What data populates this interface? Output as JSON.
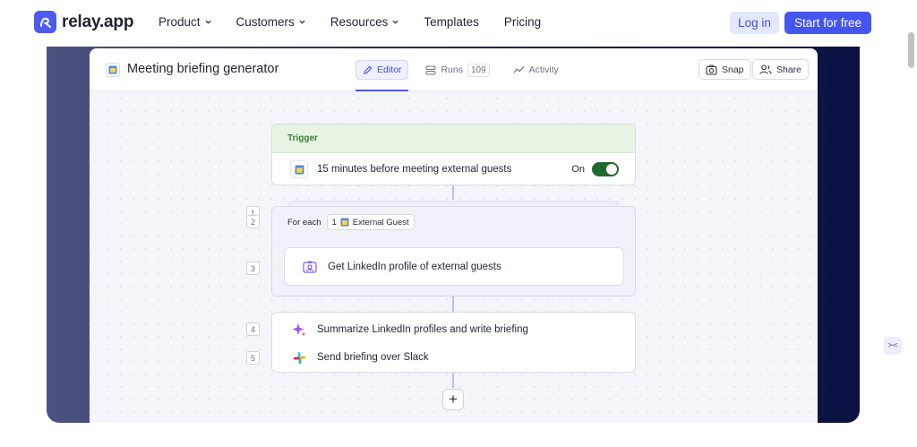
{
  "brand": {
    "name": "relay.app",
    "accent": "#4556f0"
  },
  "nav": {
    "items": [
      {
        "label": "Product",
        "has_menu": true
      },
      {
        "label": "Customers",
        "has_menu": true
      },
      {
        "label": "Resources",
        "has_menu": true
      },
      {
        "label": "Templates",
        "has_menu": false
      },
      {
        "label": "Pricing",
        "has_menu": false
      }
    ],
    "login": "Log in",
    "start": "Start for free"
  },
  "app": {
    "title": "Meeting briefing generator",
    "tabs": [
      {
        "label": "Editor",
        "icon": "pencil-icon",
        "active": true
      },
      {
        "label": "Runs",
        "icon": "runs-icon",
        "count": "109"
      },
      {
        "label": "Activity",
        "icon": "activity-icon"
      }
    ],
    "snap": "Snap",
    "share": "Share"
  },
  "flow": {
    "trigger_label": "Trigger",
    "steps": [
      {
        "num": "1",
        "text": "15 minutes before meeting external guests",
        "icon": "calendar-icon"
      },
      {
        "num": "2",
        "text": "For each",
        "icon": "loop-icon"
      },
      {
        "num": "3",
        "text": "Get LinkedIn profile of external guests",
        "icon": "id-card-icon"
      },
      {
        "num": "4",
        "text": "Summarize LinkedIn profiles and write briefing",
        "icon": "ai-sparkle-icon"
      },
      {
        "num": "5",
        "text": "Send briefing over Slack",
        "icon": "slack-icon"
      }
    ],
    "toggle_label": "On",
    "toggle_on": true,
    "foreach_ref_num": "1",
    "foreach_ref_label": "External Guest",
    "add_label": "+"
  }
}
